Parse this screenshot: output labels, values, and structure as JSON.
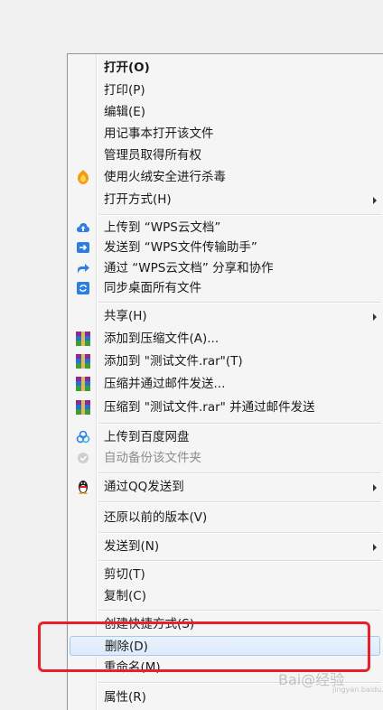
{
  "menu": {
    "items": [
      {
        "label": "打开(O)",
        "bold": true
      },
      {
        "label": "打印(P)"
      },
      {
        "label": "编辑(E)"
      },
      {
        "label": "用记事本打开该文件"
      },
      {
        "label": "管理员取得所有权"
      },
      {
        "label": "使用火绒安全进行杀毒",
        "icon": "huorong-shield-icon"
      },
      {
        "label": "打开方式(H)",
        "submenu": true
      },
      {
        "label": "上传到 “WPS云文档”",
        "icon": "cloud-upload-icon"
      },
      {
        "label": "发送到 “WPS文件传输助手”",
        "icon": "send-arrow-icon"
      },
      {
        "label": "通过 “WPS云文档” 分享和协作",
        "icon": "share-icon"
      },
      {
        "label": "同步桌面所有文件",
        "icon": "sync-desktop-icon"
      },
      {
        "label": "共享(H)",
        "submenu": true
      },
      {
        "label": "添加到压缩文件(A)...",
        "icon": "winrar-icon"
      },
      {
        "label": "添加到 \"测试文件.rar\"(T)",
        "icon": "winrar-icon"
      },
      {
        "label": "压缩并通过邮件发送...",
        "icon": "winrar-icon"
      },
      {
        "label": "压缩到 \"测试文件.rar\" 并通过邮件发送",
        "icon": "winrar-icon"
      },
      {
        "label": "上传到百度网盘",
        "icon": "baidu-netdisk-icon"
      },
      {
        "label": "自动备份该文件夹",
        "icon": "baidu-backup-icon",
        "disabled": true
      },
      {
        "label": "通过QQ发送到",
        "icon": "qq-penguin-icon",
        "submenu": true
      },
      {
        "label": "还原以前的版本(V)"
      },
      {
        "label": "发送到(N)",
        "submenu": true
      },
      {
        "label": "剪切(T)"
      },
      {
        "label": "复制(C)"
      },
      {
        "label": "创建快捷方式(S)"
      },
      {
        "label": "删除(D)",
        "hover": true
      },
      {
        "label": "重命名(M)"
      },
      {
        "label": "属性(R)"
      }
    ]
  },
  "watermark": {
    "text": "Bai@经验",
    "sub": "jingyan.baidu.com"
  },
  "colors": {
    "highlight": "#e8202a",
    "hover_bg": "#dceafb",
    "menu_bg": "#f5f5f5"
  }
}
